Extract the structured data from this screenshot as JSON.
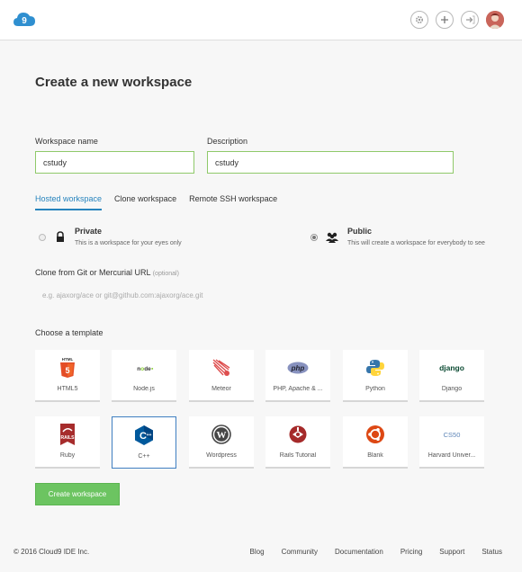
{
  "header": {
    "logo_icon": "cloud9-logo-icon",
    "settings_icon": "gear-icon",
    "add_icon": "plus-icon",
    "logout_icon": "sign-out-icon",
    "avatar_icon": "user-avatar"
  },
  "page": {
    "title": "Create a new workspace"
  },
  "form": {
    "name_label": "Workspace name",
    "name_value": "cstudy",
    "description_label": "Description",
    "description_value": "cstudy"
  },
  "tabs": [
    {
      "label": "Hosted workspace",
      "active": true
    },
    {
      "label": "Clone workspace",
      "active": false
    },
    {
      "label": "Remote SSH workspace",
      "active": false
    }
  ],
  "visibility": {
    "private_title": "Private",
    "private_desc": "This is a workspace for your eyes only",
    "public_title": "Public",
    "public_desc": "This will create a workspace for everybody to see"
  },
  "clone": {
    "label": "Clone from Git or Mercurial URL",
    "optional": "(optional)",
    "placeholder": "e.g. ajaxorg/ace or git@github.com:ajaxorg/ace.git"
  },
  "templates": {
    "label": "Choose a template",
    "items": [
      {
        "label": "HTML5",
        "icon": "html5-icon"
      },
      {
        "label": "Node.js",
        "icon": "nodejs-icon"
      },
      {
        "label": "Meteor",
        "icon": "meteor-icon"
      },
      {
        "label": "PHP, Apache & ...",
        "icon": "php-icon"
      },
      {
        "label": "Python",
        "icon": "python-icon"
      },
      {
        "label": "Django",
        "icon": "django-icon"
      },
      {
        "label": "Ruby",
        "icon": "rails-icon"
      },
      {
        "label": "C++",
        "icon": "cpp-icon",
        "selected": true
      },
      {
        "label": "Wordpress",
        "icon": "wordpress-icon"
      },
      {
        "label": "Rails Tutorial",
        "icon": "rails-tutorial-icon"
      },
      {
        "label": "Blank",
        "icon": "ubuntu-icon"
      },
      {
        "label": "Harvard Univer...",
        "icon": "cs50-icon"
      }
    ]
  },
  "create_button": "Create workspace",
  "footer": {
    "copyright": "© 2016 Cloud9 IDE Inc.",
    "links": [
      "Blog",
      "Community",
      "Documentation",
      "Pricing",
      "Support",
      "Status"
    ]
  },
  "colors": {
    "accent": "#2683bd",
    "input_border": "#8fc96a",
    "create_button": "#6cc461",
    "selected_tile": "#3f7fc1"
  }
}
